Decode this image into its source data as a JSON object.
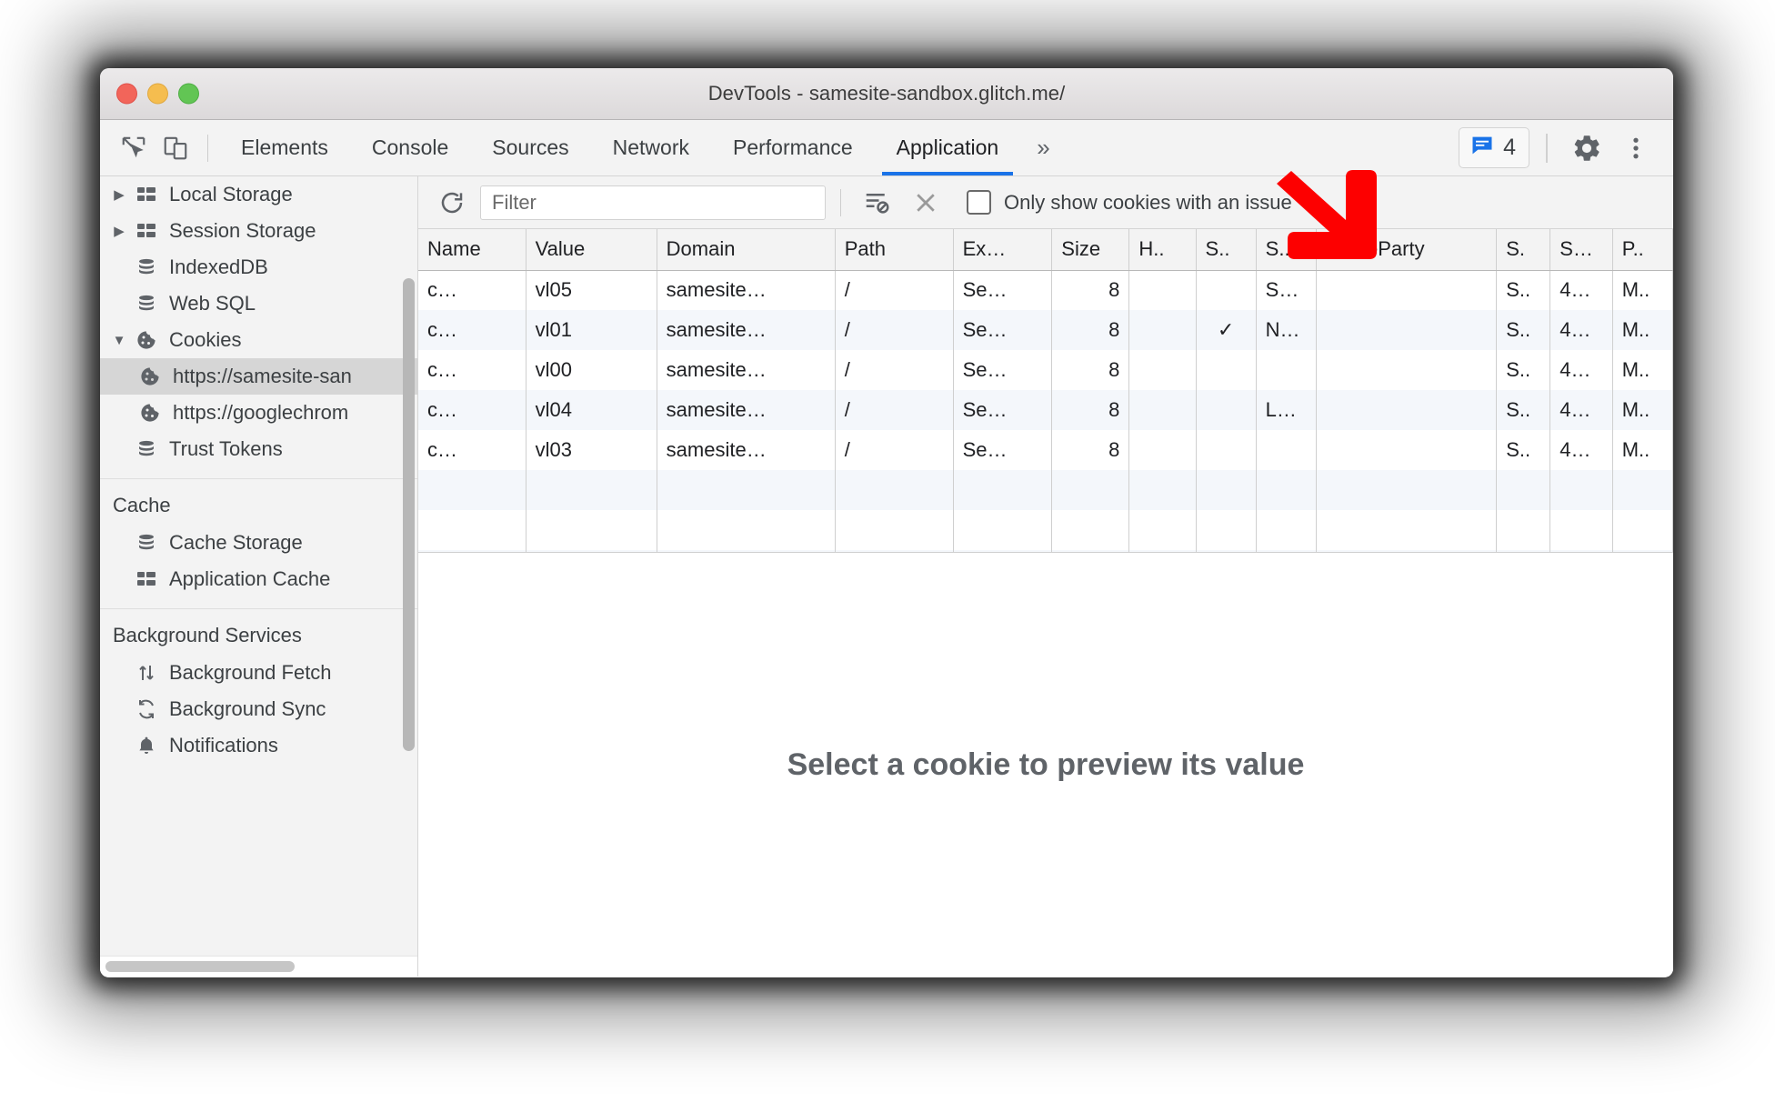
{
  "window": {
    "title": "DevTools - samesite-sandbox.glitch.me/",
    "traffic_lights": [
      "close-red",
      "minimize-yellow",
      "maximize-green"
    ]
  },
  "toolbar": {
    "inspect_icon": "inspect-element-icon",
    "device_icon": "device-toolbar-icon",
    "tabs": [
      {
        "label": "Elements",
        "active": false
      },
      {
        "label": "Console",
        "active": false
      },
      {
        "label": "Sources",
        "active": false
      },
      {
        "label": "Network",
        "active": false
      },
      {
        "label": "Performance",
        "active": false
      },
      {
        "label": "Application",
        "active": true
      }
    ],
    "more_tabs_label": "»",
    "issues_icon": "issues-message-icon",
    "issues_count": "4",
    "issues_color": "#1a73e8",
    "settings_icon": "gear-icon",
    "menu_icon": "kebab-menu-icon",
    "active_tab_underline_color": "#1a73e8"
  },
  "sidebar": {
    "storage_items": [
      {
        "label": "Local Storage",
        "icon": "table-storage-icon",
        "twisty": "▶",
        "indent": 1,
        "selected": false
      },
      {
        "label": "Session Storage",
        "icon": "table-storage-icon",
        "twisty": "▶",
        "indent": 1,
        "selected": false
      },
      {
        "label": "IndexedDB",
        "icon": "database-icon",
        "twisty": "",
        "indent": 1,
        "selected": false
      },
      {
        "label": "Web SQL",
        "icon": "database-icon",
        "twisty": "",
        "indent": 1,
        "selected": false
      },
      {
        "label": "Cookies",
        "icon": "cookie-icon",
        "twisty": "▼",
        "indent": 1,
        "selected": false
      },
      {
        "label": "https://samesite-san",
        "icon": "cookie-icon",
        "twisty": "",
        "indent": 2,
        "selected": true
      },
      {
        "label": "https://googlechrom",
        "icon": "cookie-icon",
        "twisty": "",
        "indent": 2,
        "selected": false
      },
      {
        "label": "Trust Tokens",
        "icon": "database-icon",
        "twisty": "",
        "indent": 1,
        "selected": false
      }
    ],
    "cache_group_title": "Cache",
    "cache_items": [
      {
        "label": "Cache Storage",
        "icon": "database-icon"
      },
      {
        "label": "Application Cache",
        "icon": "table-storage-icon"
      }
    ],
    "background_group_title": "Background Services",
    "background_items": [
      {
        "label": "Background Fetch",
        "icon": "arrows-updown-icon"
      },
      {
        "label": "Background Sync",
        "icon": "sync-icon"
      },
      {
        "label": "Notifications",
        "icon": "bell-icon"
      }
    ]
  },
  "cookie_toolbar": {
    "refresh_icon": "refresh-icon",
    "filter_value": "",
    "filter_placeholder": "Filter",
    "clear_filtered_icon": "clear-filtered-cookies-icon",
    "clear_all_icon": "clear-all-cookies-icon",
    "only_issues_label": "Only show cookies with an issue",
    "only_issues_checked": false
  },
  "table": {
    "columns": [
      {
        "key": "name",
        "label": "Name",
        "class": "c-name"
      },
      {
        "key": "value",
        "label": "Value",
        "class": "c-value"
      },
      {
        "key": "domain",
        "label": "Domain",
        "class": "c-domain"
      },
      {
        "key": "path",
        "label": "Path",
        "class": "c-path"
      },
      {
        "key": "expires",
        "label": "Ex…",
        "class": "c-expire"
      },
      {
        "key": "size",
        "label": "Size",
        "class": "c-size"
      },
      {
        "key": "httponly",
        "label": "H..",
        "class": "c-http"
      },
      {
        "key": "secure",
        "label": "S..",
        "class": "c-secure"
      },
      {
        "key": "samesite",
        "label": "S..",
        "class": "c-ss"
      },
      {
        "key": "sameparty",
        "label": "SameParty",
        "class": "c-sp"
      },
      {
        "key": "partitionkey",
        "label": "S.",
        "class": "c-pk"
      },
      {
        "key": "priority",
        "label": "S…",
        "class": "c-pr"
      },
      {
        "key": "lastcol",
        "label": "P..",
        "class": "c-last"
      }
    ],
    "rows": [
      {
        "name": "c…",
        "value": "vl05",
        "domain": "samesite…",
        "path": "/",
        "expires": "Se…",
        "size": "8",
        "httponly": "",
        "secure": "",
        "samesite": "S…",
        "sameparty": "",
        "partitionkey": "S..",
        "priority": "4…",
        "lastcol": "M.."
      },
      {
        "name": "c…",
        "value": "vl01",
        "domain": "samesite…",
        "path": "/",
        "expires": "Se…",
        "size": "8",
        "httponly": "",
        "secure": "✓",
        "samesite": "N…",
        "sameparty": "",
        "partitionkey": "S..",
        "priority": "4…",
        "lastcol": "M.."
      },
      {
        "name": "c…",
        "value": "vl00",
        "domain": "samesite…",
        "path": "/",
        "expires": "Se…",
        "size": "8",
        "httponly": "",
        "secure": "",
        "samesite": "",
        "sameparty": "",
        "partitionkey": "S..",
        "priority": "4…",
        "lastcol": "M.."
      },
      {
        "name": "c…",
        "value": "vl04",
        "domain": "samesite…",
        "path": "/",
        "expires": "Se…",
        "size": "8",
        "httponly": "",
        "secure": "",
        "samesite": "L…",
        "sameparty": "",
        "partitionkey": "S..",
        "priority": "4…",
        "lastcol": "M.."
      },
      {
        "name": "c…",
        "value": "vl03",
        "domain": "samesite…",
        "path": "/",
        "expires": "Se…",
        "size": "8",
        "httponly": "",
        "secure": "",
        "samesite": "",
        "sameparty": "",
        "partitionkey": "S..",
        "priority": "4…",
        "lastcol": "M.."
      }
    ],
    "empty_row_count": 2
  },
  "preview": {
    "empty_message": "Select a cookie to preview its value"
  },
  "annotation": {
    "arrow_color": "#fd0000",
    "arrow_name": "red-annotation-arrow",
    "points_at": "SameSite column header"
  }
}
